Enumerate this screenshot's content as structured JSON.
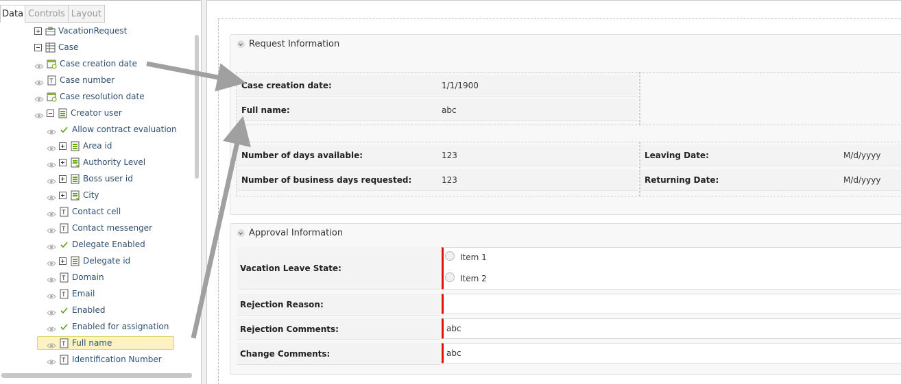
{
  "tabs": [
    "Data",
    "Controls",
    "Layout"
  ],
  "tree": [
    {
      "label": "VacationRequest",
      "expander": "plus",
      "icon": "business-object-icon",
      "eye": false
    },
    {
      "label": "Case",
      "expander": "minus",
      "icon": "entity-grid-icon",
      "eye": false
    },
    {
      "label": "Case creation date",
      "expander": "",
      "icon": "calendar-icon",
      "eye": true
    },
    {
      "label": "Case number",
      "expander": "",
      "icon": "text-field-icon",
      "eye": true
    },
    {
      "label": "Case resolution date",
      "expander": "",
      "icon": "calendar-icon",
      "eye": true
    },
    {
      "label": "Creator user",
      "expander": "minus",
      "icon": "entity-icon",
      "eye": true
    },
    {
      "label": "Allow contract evaluation",
      "expander": "",
      "icon": "checkmark-icon",
      "eye": true
    },
    {
      "label": "Area id",
      "expander": "plus",
      "icon": "entity-icon",
      "eye": true
    },
    {
      "label": "Authority Level",
      "expander": "plus",
      "icon": "entity-list-icon",
      "eye": true
    },
    {
      "label": "Boss user id",
      "expander": "plus",
      "icon": "entity-icon",
      "eye": true
    },
    {
      "label": "City",
      "expander": "plus",
      "icon": "entity-list-icon",
      "eye": true
    },
    {
      "label": "Contact cell",
      "expander": "",
      "icon": "text-field-icon",
      "eye": true
    },
    {
      "label": "Contact messenger",
      "expander": "",
      "icon": "text-field-icon",
      "eye": true
    },
    {
      "label": "Delegate Enabled",
      "expander": "",
      "icon": "checkmark-icon",
      "eye": true
    },
    {
      "label": "Delegate id",
      "expander": "plus",
      "icon": "entity-icon",
      "eye": true
    },
    {
      "label": "Domain",
      "expander": "",
      "icon": "text-field-icon",
      "eye": true
    },
    {
      "label": "Email",
      "expander": "",
      "icon": "text-field-icon",
      "eye": true
    },
    {
      "label": "Enabled",
      "expander": "",
      "icon": "checkmark-icon",
      "eye": true
    },
    {
      "label": "Enabled for assignation",
      "expander": "",
      "icon": "checkmark-icon",
      "eye": true
    },
    {
      "label": "Full name",
      "expander": "",
      "icon": "text-field-icon",
      "eye": true,
      "selected": true
    },
    {
      "label": "Identification Number",
      "expander": "",
      "icon": "text-field-icon",
      "eye": true
    }
  ],
  "request": {
    "title": "Request Information",
    "case_creation_label": "Case creation date:",
    "case_creation_value": "1/1/1900",
    "full_name_label": "Full name:",
    "full_name_value": "abc",
    "days_available_label": "Number of days available:",
    "days_available_value": "123",
    "business_days_label": "Number of business days requested:",
    "business_days_value": "123",
    "leaving_label": "Leaving Date:",
    "leaving_value": "M/d/yyyy",
    "returning_label": "Returning Date:",
    "returning_value": "M/d/yyyy"
  },
  "approval": {
    "title": "Approval Information",
    "state_label": "Vacation Leave State:",
    "options": [
      "Item 1",
      "Item 2"
    ],
    "rejection_reason_label": "Rejection Reason:",
    "rejection_reason_value": "",
    "rejection_comments_label": "Rejection Comments:",
    "rejection_comments_value": "abc",
    "change_comments_label": "Change Comments:",
    "change_comments_value": "abc"
  },
  "colors": {
    "required": "#e01010",
    "arrow": "#a0a0a0",
    "selection": "#fdf2c4"
  }
}
